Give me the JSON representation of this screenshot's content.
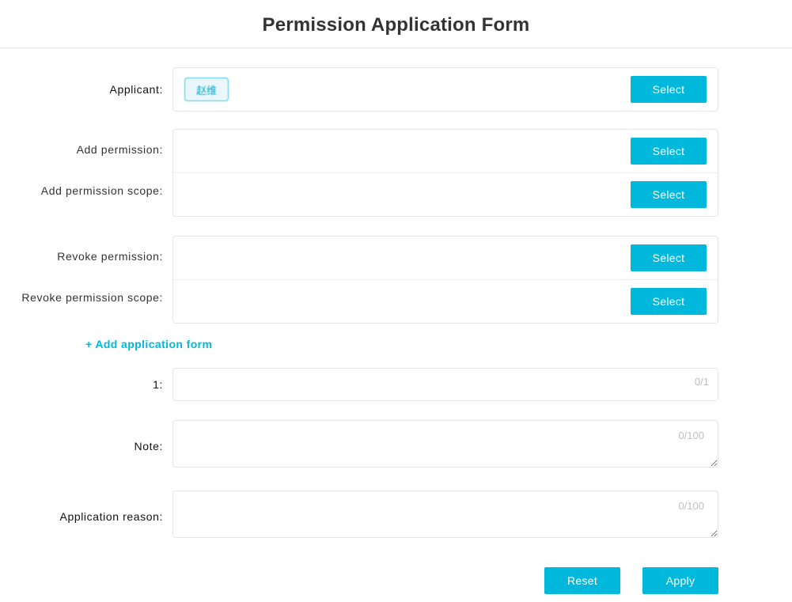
{
  "title": "Permission Application Form",
  "label_suffix": ":",
  "applicant": {
    "label": "Applicant",
    "chip_text": "赵维",
    "select_label": "Select"
  },
  "add_perm": {
    "row1_label": "Add permission",
    "row2_label": "Add permission scope",
    "select_label": "Select"
  },
  "revoke_perm": {
    "row1_label": "Revoke permission",
    "row2_label": "Revoke permission scope",
    "select_label": "Select"
  },
  "add_form_link": "+ Add application form",
  "field_1": {
    "label": "1",
    "counter": "0/1"
  },
  "note": {
    "label": "Note",
    "counter": "0/100"
  },
  "reason": {
    "label": "Application reason",
    "counter": "0/100"
  },
  "buttons": {
    "reset": "Reset",
    "apply": "Apply"
  }
}
